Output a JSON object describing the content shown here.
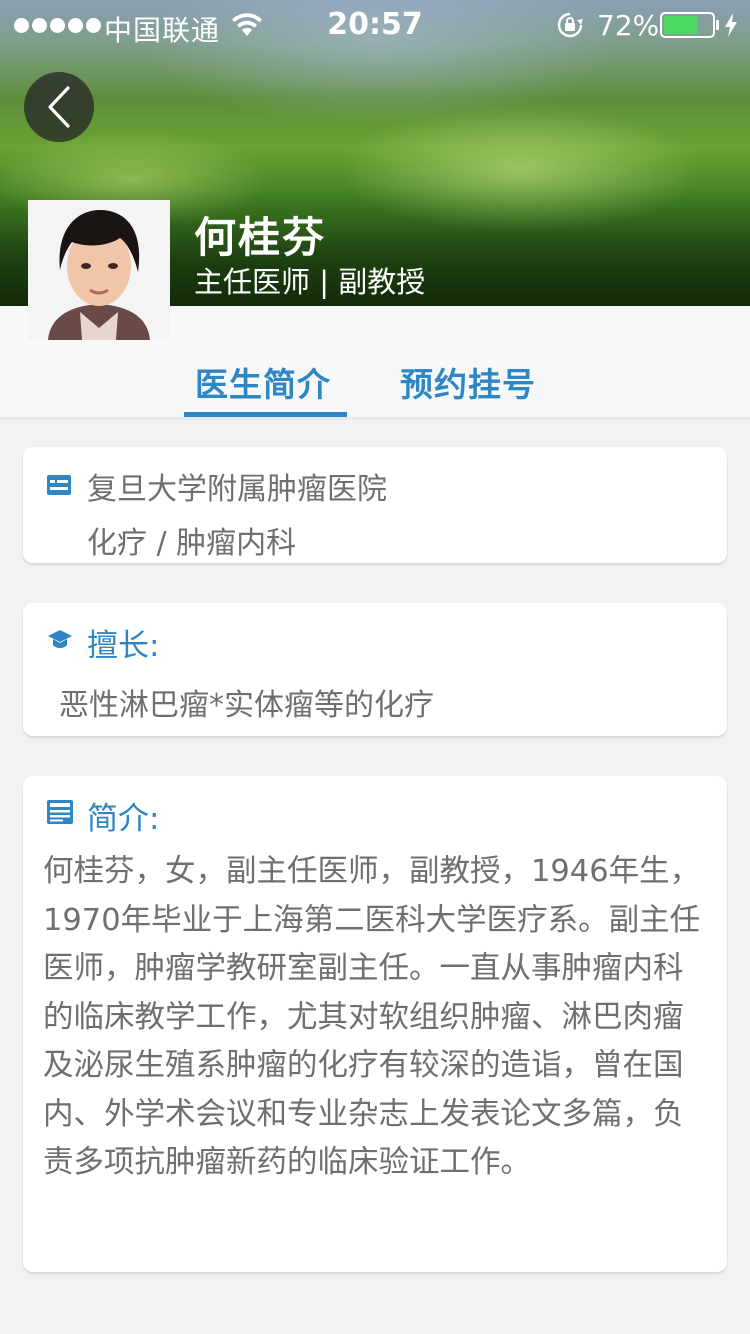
{
  "status_bar": {
    "carrier": "中国联通",
    "time": "20:57",
    "battery_percent": "72%",
    "battery_level": 0.72
  },
  "header": {
    "doctor_name": "何桂芬",
    "doctor_title": "主任医师 | 副教授"
  },
  "tabs": [
    {
      "label": "医生简介",
      "active": true
    },
    {
      "label": "预约挂号",
      "active": false
    }
  ],
  "hospital_card": {
    "hospital": "复旦大学附属肿瘤医院",
    "department": "化疗 / 肿瘤内科"
  },
  "specialty_card": {
    "heading": "擅长:",
    "text": "恶性淋巴瘤*实体瘤等的化疗"
  },
  "bio_card": {
    "heading": "简介:",
    "text": "何桂芬，女，副主任医师，副教授，1946年生，1970年毕业于上海第二医科大学医疗系。副主任医师，肿瘤学教研室副主任。一直从事肿瘤内科的临床教学工作，尤其对软组织肿瘤、淋巴肉瘤及泌尿生殖系肿瘤的化疗有较深的造诣，曾在国内、外学术会议和专业杂志上发表论文多篇，负责多项抗肿瘤新药的临床验证工作。"
  },
  "colors": {
    "accent": "#2e86c4",
    "body_text": "#6f6f6f",
    "background": "#f1f2f4"
  },
  "icons": {
    "back": "chevron-left-icon",
    "hospital": "id-card-icon",
    "specialty": "graduation-cap-icon",
    "bio": "document-icon"
  }
}
